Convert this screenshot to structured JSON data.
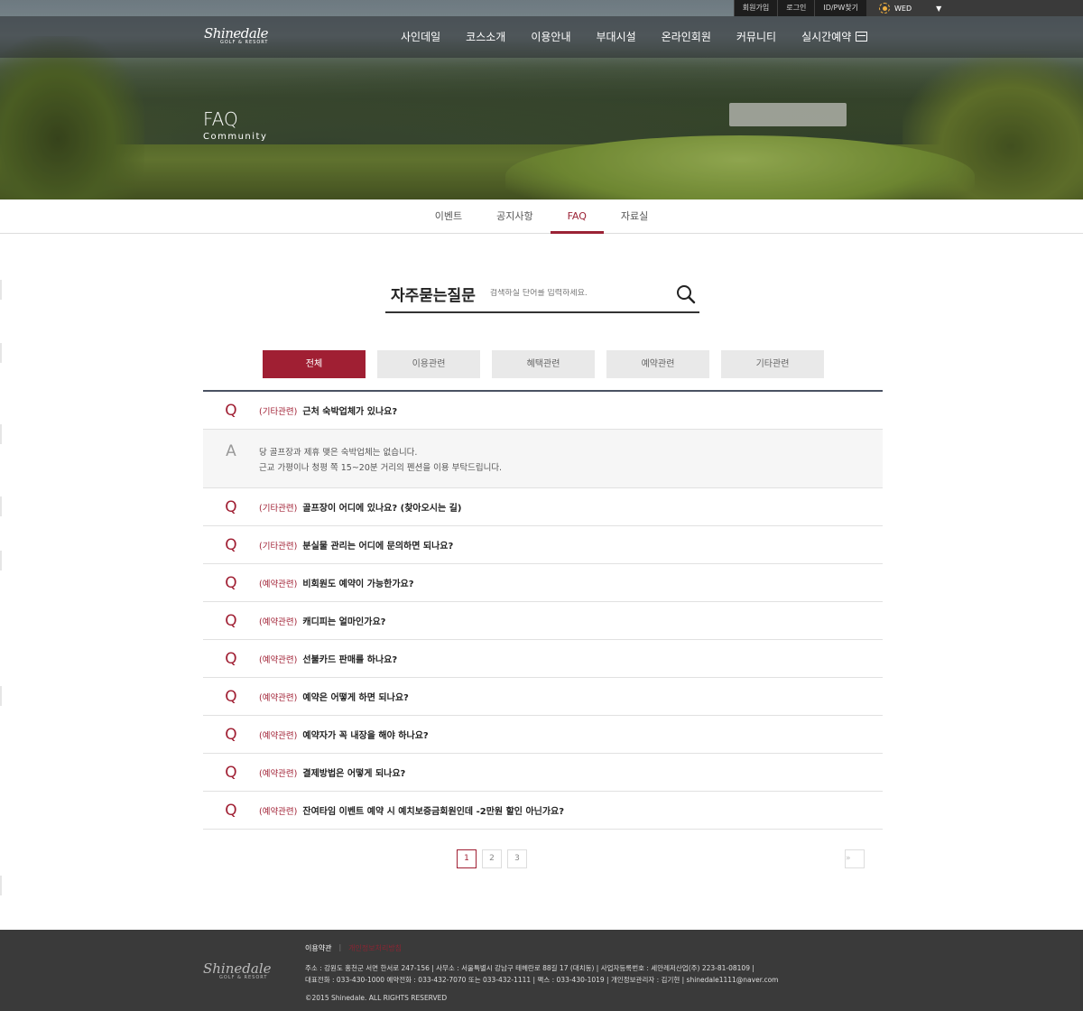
{
  "topbar": {
    "links": [
      "회원가입",
      "로그인",
      "ID/PW찾기"
    ],
    "weather_day": "WED"
  },
  "logo": {
    "name": "Shinedale",
    "sub": "GOLF & RESORT"
  },
  "nav": {
    "items": [
      "사인데일",
      "코스소개",
      "이용안내",
      "부대시설",
      "온라인회원",
      "커뮤니티",
      "실시간예약"
    ]
  },
  "hero": {
    "title": "FAQ",
    "subtitle": "Community"
  },
  "subtabs": [
    "이벤트",
    "공지사항",
    "FAQ",
    "자료실"
  ],
  "search": {
    "label": "자주묻는질문",
    "placeholder": "검색하실 단어를 입력하세요."
  },
  "categories": [
    "전체",
    "이용관련",
    "혜택관련",
    "예약관련",
    "기타관련"
  ],
  "faq": {
    "q_marker": "Q",
    "a_marker": "A",
    "first": {
      "tag": "(기타관련)",
      "question": "근처 숙박업체가 있나요?"
    },
    "answer_lines": [
      "당 골프장과 제휴 맺은 숙박업체는 없습니다.",
      "근교 가평이나 청평 쪽 15~20분 거리의 펜션을 이용 부탁드립니다."
    ],
    "items": [
      {
        "tag": "(기타관련)",
        "question": "골프장이 어디에 있나요? (찾아오시는 길)"
      },
      {
        "tag": "(기타관련)",
        "question": "분실물 관리는 어디에 문의하면 되나요?"
      },
      {
        "tag": "(예약관련)",
        "question": "비회원도 예약이 가능한가요?"
      },
      {
        "tag": "(예약관련)",
        "question": "캐디피는 얼마인가요?"
      },
      {
        "tag": "(예약관련)",
        "question": "선불카드 판매를 하나요?"
      },
      {
        "tag": "(예약관련)",
        "question": "예약은 어떻게 하면 되나요?"
      },
      {
        "tag": "(예약관련)",
        "question": "예약자가 꼭 내장을 해야 하나요?"
      },
      {
        "tag": "(예약관련)",
        "question": "결제방법은 어떻게 되나요?"
      },
      {
        "tag": "(예약관련)",
        "question": "잔여타임 이벤트 예약 시 예치보증금회원인데 -2만원 할인 아닌가요?"
      }
    ]
  },
  "pagination": {
    "first": "«",
    "prev": "‹",
    "pages": [
      "1",
      "2",
      "3"
    ],
    "next": "›",
    "last": "»"
  },
  "footer": {
    "link1": "이용약관",
    "link2": "개인정보처리방침",
    "line1": "주소 : 강원도 홍천군 서면 한서로 247-156  |  사무소 : 서울특별시 강남구 테헤란로 88길 17 (대치동)  |  사업자등록번호 : 세안레저산업(주) 223-81-08109  |",
    "line2": "대표전화 : 033-430-1000 예약전화 : 033-432-7070 또는 033-432-1111  |  팩스 : 033-430-1019  |  개인정보관리자 : 김기현  |  shinedale1111@naver.com",
    "copyright": "©2015 Shinedale. ALL RIGHTS RESERVED"
  },
  "colors": {
    "accent": "#a01f33",
    "footer_bg": "#3a3a3a",
    "list_top_border": "#4a5262"
  }
}
